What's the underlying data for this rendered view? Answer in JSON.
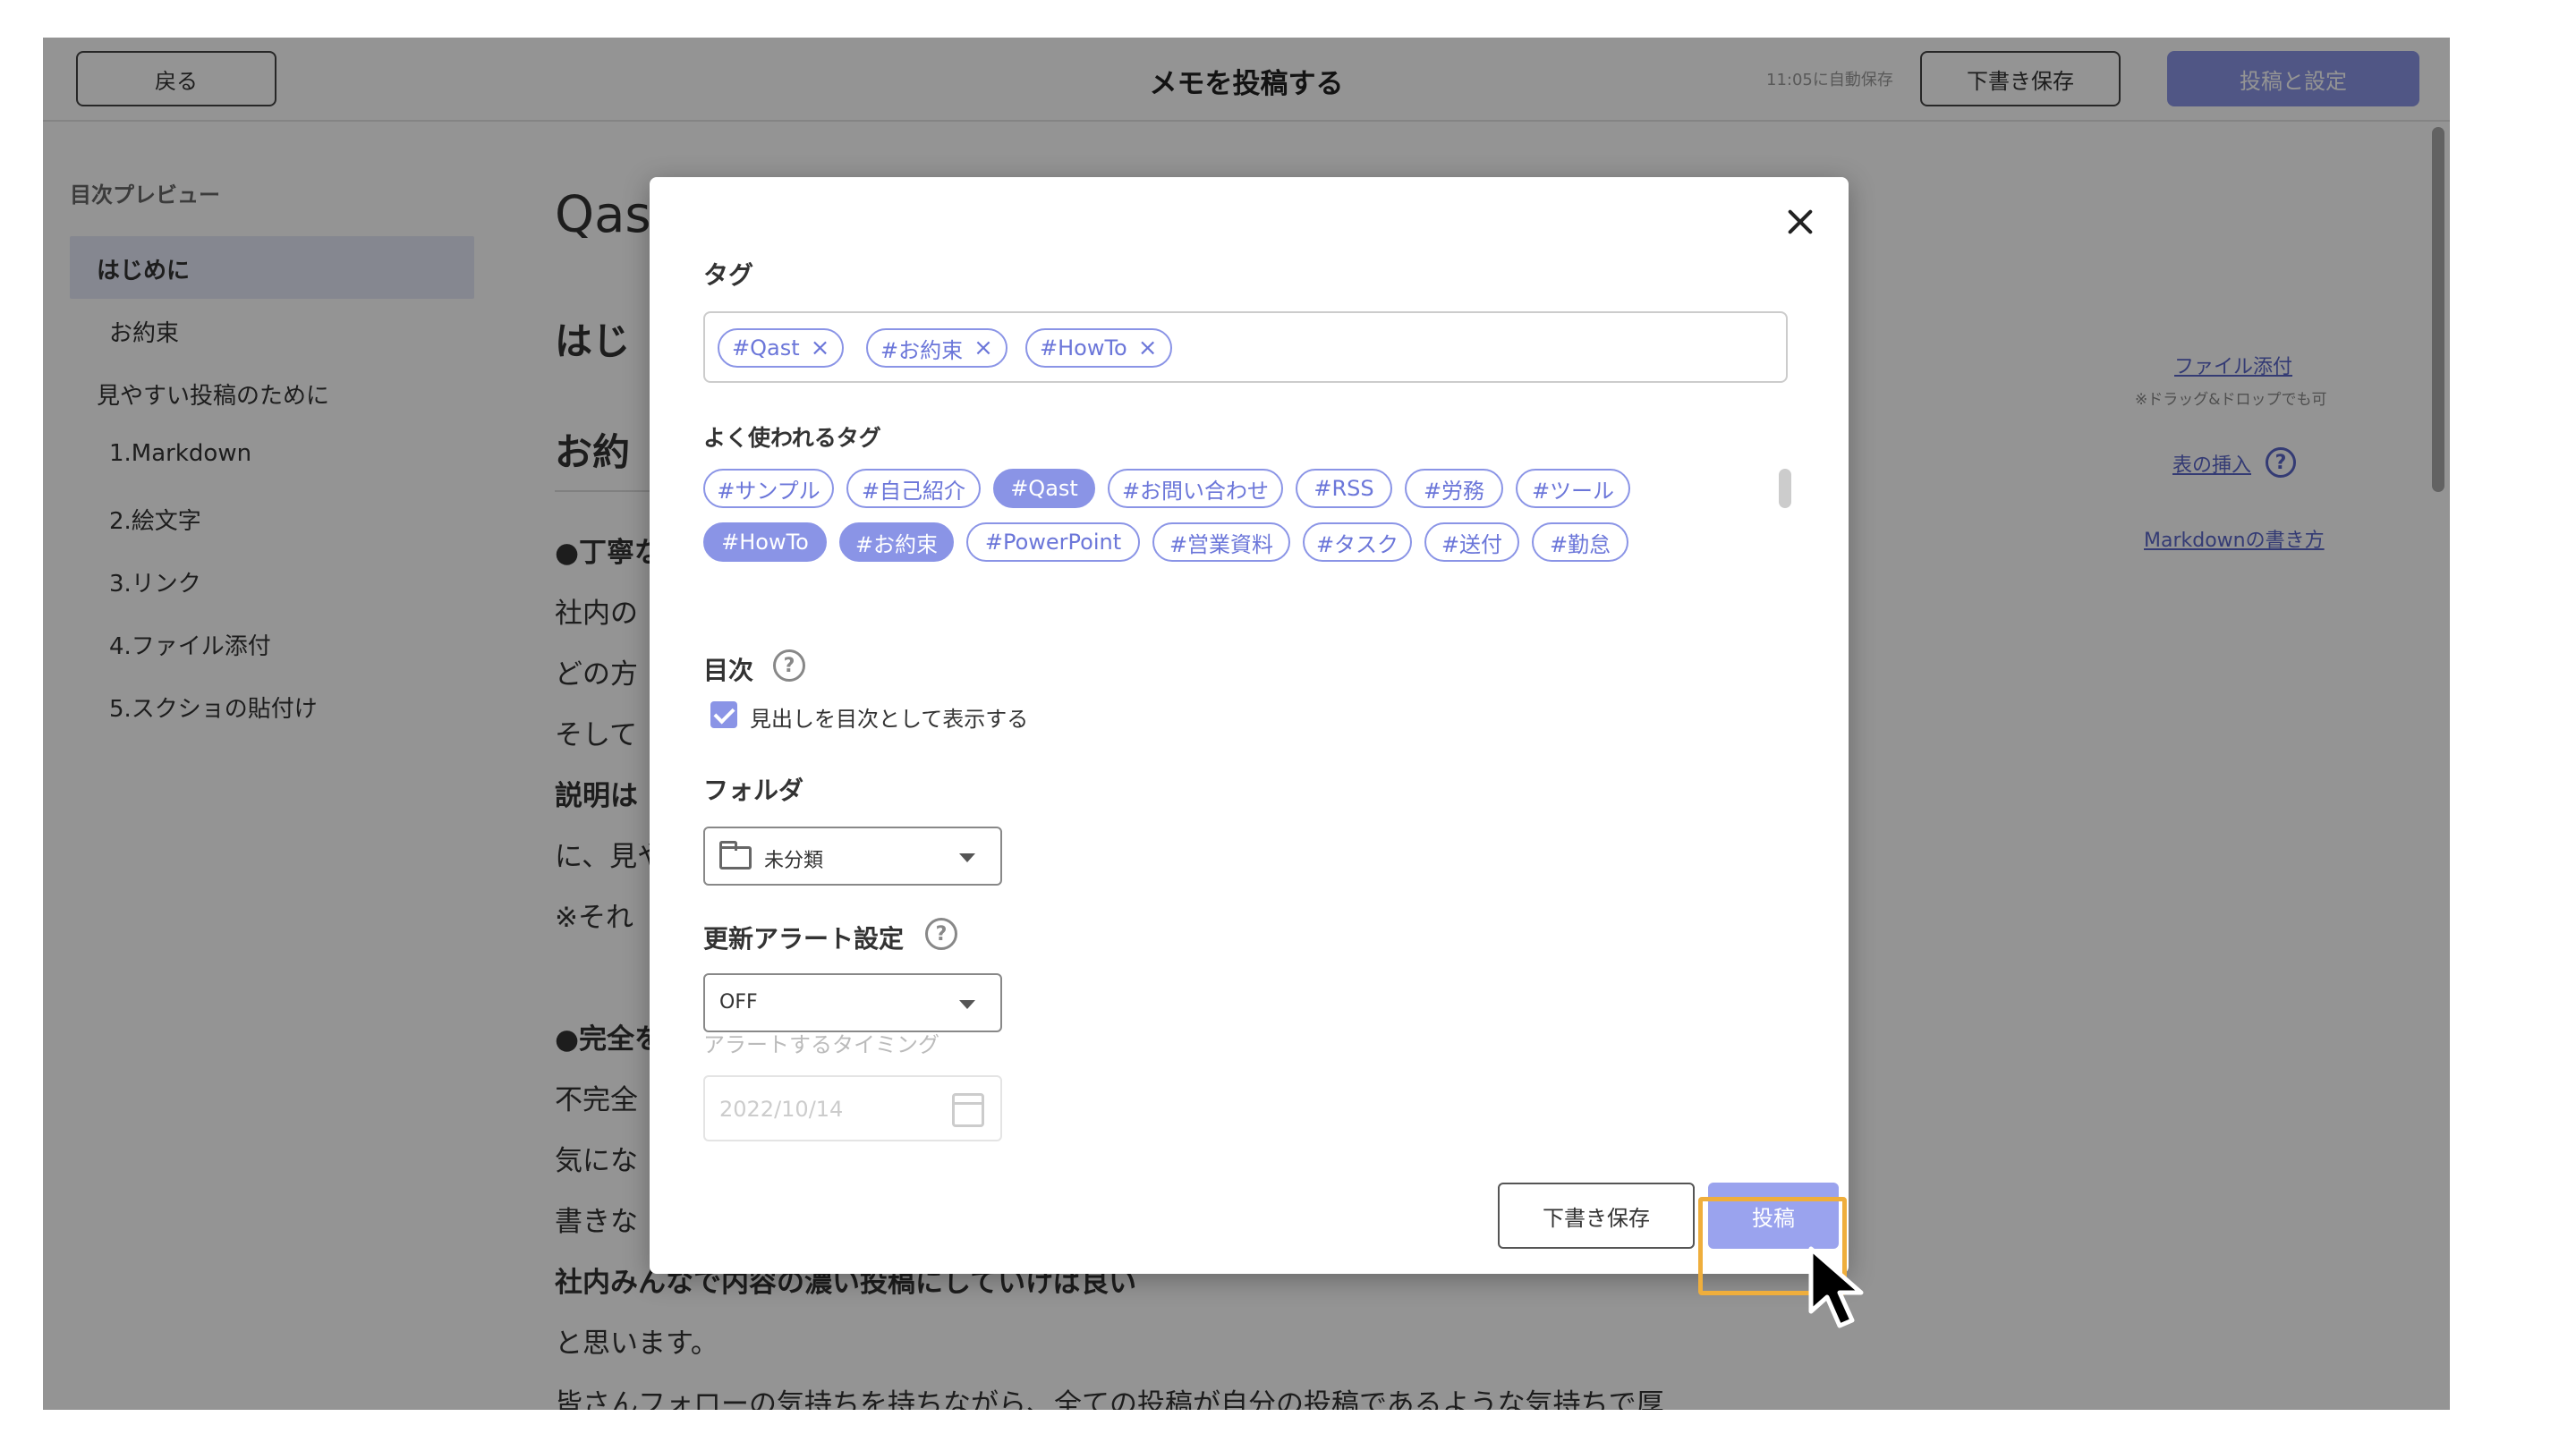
{
  "header": {
    "back_label": "戻る",
    "title": "メモを投稿する",
    "autosave": "11:05に自動保存",
    "draft_label": "下書き保存",
    "post_label": "投稿と設定"
  },
  "sidebar": {
    "title": "目次プレビュー",
    "items": [
      {
        "label": "はじめに"
      },
      {
        "label": "お約束"
      },
      {
        "label": "見やすい投稿のために"
      },
      {
        "label": "1.Markdown"
      },
      {
        "label": "2.絵文字"
      },
      {
        "label": "3.リンク"
      },
      {
        "label": "4.ファイル添付"
      },
      {
        "label": "5.スクショの貼付け"
      }
    ]
  },
  "content": {
    "title_partial": "Qas",
    "lines": [
      "はじ",
      "お約",
      "●丁寧な",
      "社内の",
      "どの方",
      "そして",
      "説明は",
      "に、見や",
      "※それ",
      "●完全を",
      "不完全",
      "気にな",
      "書きな",
      "社内みんなで内容の濃い投稿にしていけば良い",
      "と思います。",
      "皆さんフォローの気持ちを持ちながら、全ての投稿が自分の投稿であるような気持ちで厚"
    ]
  },
  "right_panel": {
    "attach_link": "ファイル添付",
    "attach_note": "※ドラッグ&ドロップでも可",
    "table_link": "表の挿入",
    "markdown_link": "Markdownの書き方"
  },
  "modal": {
    "tags_label": "タグ",
    "selected_tags": [
      "#Qast",
      "#お約束",
      "#HowTo"
    ],
    "frequent_label": "よく使われるタグ",
    "frequent_tags": [
      {
        "label": "#サンプル"
      },
      {
        "label": "#自己紹介"
      },
      {
        "label": "#Qast"
      },
      {
        "label": "#お問い合わせ"
      },
      {
        "label": "#RSS"
      },
      {
        "label": "#労務"
      },
      {
        "label": "#ツール"
      },
      {
        "label": "#HowTo"
      },
      {
        "label": "#お約束"
      },
      {
        "label": "#PowerPoint"
      },
      {
        "label": "#営業資料"
      },
      {
        "label": "#タスク"
      },
      {
        "label": "#送付"
      },
      {
        "label": "#勤怠"
      }
    ],
    "toc_label": "目次",
    "toc_checkbox_label": "見出しを目次として表示する",
    "folder_label": "フォルダ",
    "folder_value": "未分類",
    "alert_label": "更新アラート設定",
    "alert_value": "OFF",
    "alert_timing_label": "アラートするタイミング",
    "alert_timing_placeholder": "2022/10/14",
    "draft_label": "下書き保存",
    "post_label": "投稿"
  },
  "colors": {
    "accent": "#8a94e6",
    "highlight": "#efae3c"
  }
}
